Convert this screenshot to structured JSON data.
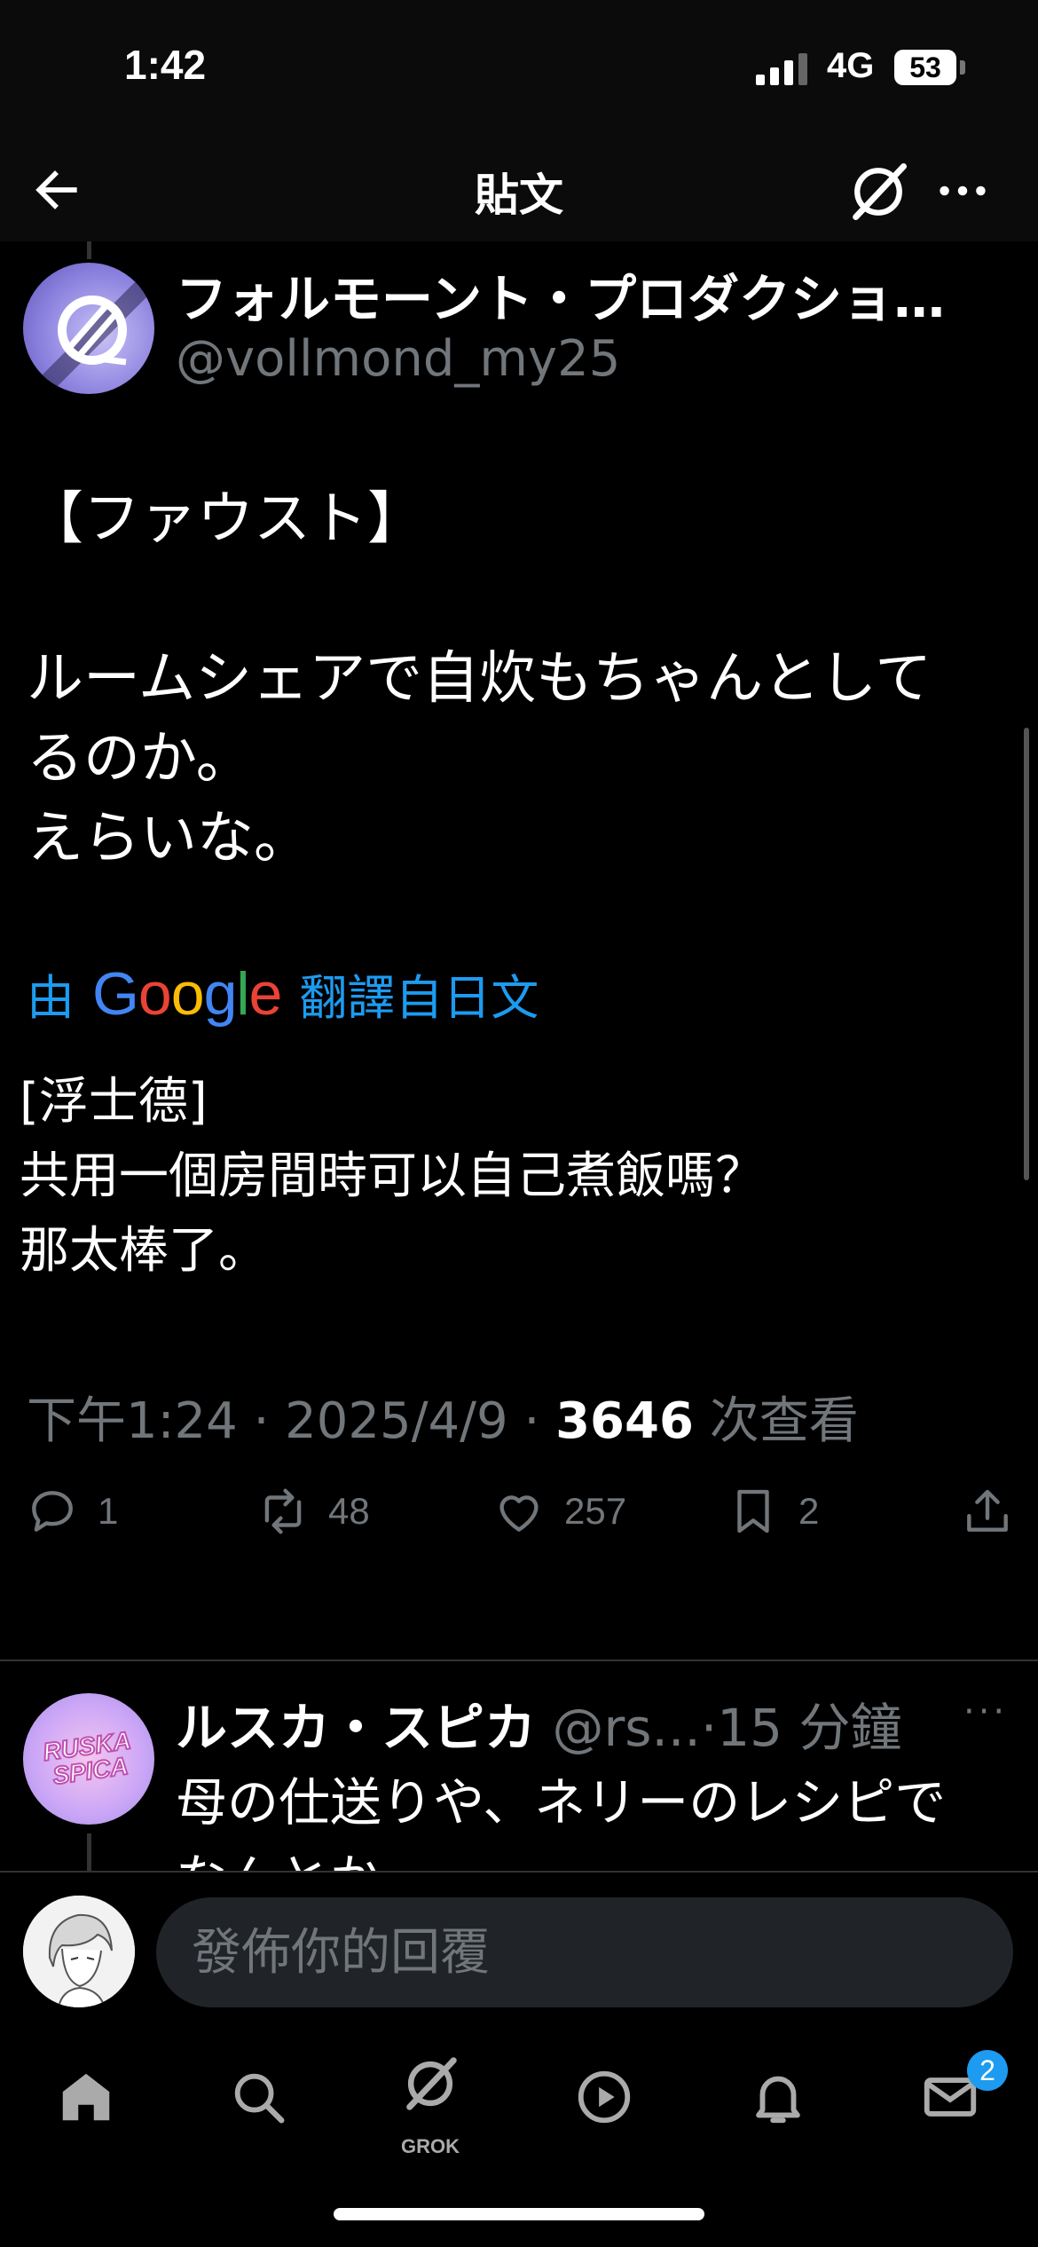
{
  "status_bar": {
    "time": "1:42",
    "network": "4G",
    "battery": "53"
  },
  "header": {
    "title": "貼文",
    "back_icon": "arrow-left-icon",
    "grok_icon": "grok-icon",
    "more_icon": "more-horizontal-icon"
  },
  "post": {
    "author_name": "フォルモーント・プロダクショ…",
    "author_handle": "@vollmond_my25",
    "body": "【ファウスト】\n\nルームシェアで自炊もちゃんとして\nるのか。\nえらいな。",
    "translate_prefix": "由",
    "translate_brand": "Google",
    "translate_suffix": "翻譯自日文",
    "translated_text": "[浮士德]\n共用一個房間時可以自己煮飯嗎？\n那太棒了。",
    "time": "下午1:24",
    "date": "2025/4/9",
    "views_count": "3646",
    "views_label": "次查看",
    "actions": {
      "replies": "1",
      "reposts": "48",
      "likes": "257",
      "bookmarks": "2"
    }
  },
  "reply": {
    "name": "ルスカ・スピカ",
    "handle": "@rs...",
    "time": "15 分鐘",
    "avatar_text": "RUSKA SPICA",
    "text": "母の仕送りや、ネリーのレシピで\nなんとか……。"
  },
  "composer": {
    "placeholder": "發佈你的回覆"
  },
  "tab_bar": {
    "grok_label": "GROK",
    "messages_badge": "2"
  },
  "colors": {
    "background": "#000000",
    "accent": "#1d9bf0",
    "secondary_text": "#71767b"
  }
}
